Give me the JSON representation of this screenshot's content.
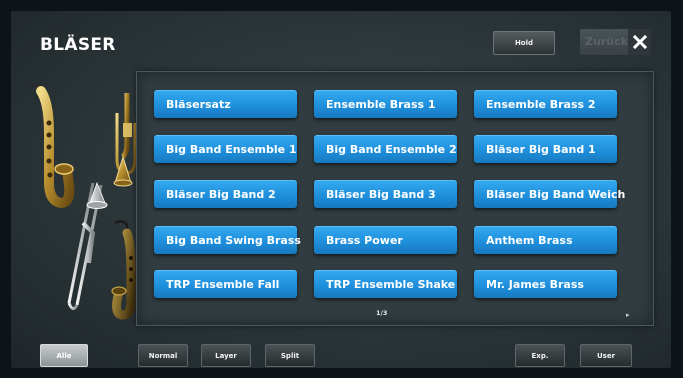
{
  "header": {
    "title": "BLÄSER",
    "hold_label": "Hold",
    "back_label": "Zurück",
    "close_icon": "close-icon"
  },
  "sounds": [
    "Bläsersatz",
    "Ensemble Brass 1",
    "Ensemble Brass 2",
    "Big Band Ensemble 1",
    "Big Band Ensemble 2",
    "Bläser Big Band 1",
    "Bläser Big Band 2",
    "Bläser Big Band 3",
    "Bläser Big Band Weich",
    "Big Band Swing Brass",
    "Brass Power",
    "Anthem Brass",
    "TRP Ensemble Fall",
    "TRP Ensemble Shake",
    "Mr. James Brass"
  ],
  "pagination": {
    "indicator": "1/3"
  },
  "bottom_bar": {
    "all_label": "Alle",
    "normal_label": "Normal",
    "layer_label": "Layer",
    "split_label": "Split",
    "exp_label": "Exp.",
    "user_label": "User",
    "selected": "Alle"
  },
  "colors": {
    "button_blue": "#2196e3",
    "background": "#2b3538",
    "active_button": "#b4b9bb"
  }
}
